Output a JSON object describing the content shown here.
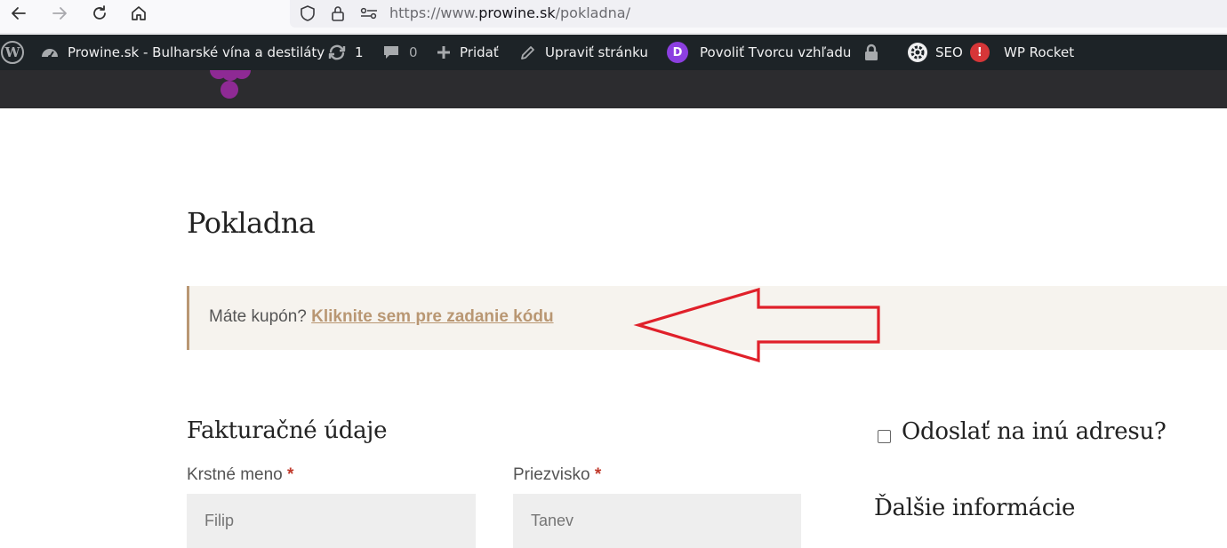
{
  "browser": {
    "url_prefix": "https://www.",
    "url_host": "prowine.sk",
    "url_path": "/pokladna/"
  },
  "admin_bar": {
    "site_name": "Prowine.sk - Bulharské vína a destiláty",
    "updates_count": "1",
    "comments_count": "0",
    "add_new_label": "Pridať",
    "edit_page_label": "Upraviť stránku",
    "divi_letter": "D",
    "divi_label": "Povoliť Tvorcu vzhľadu",
    "seo_label": "SEO",
    "seo_alert": "!",
    "wp_rocket_label": "WP Rocket"
  },
  "page": {
    "title": "Pokladna",
    "coupon": {
      "prompt": "Máte kupón?",
      "link": "Kliknite sem pre zadanie kódu"
    },
    "billing": {
      "heading": "Fakturačné údaje",
      "first_name_label": "Krstné meno",
      "last_name_label": "Priezvisko",
      "required_mark": "*",
      "first_name_placeholder": "Filip",
      "last_name_placeholder": "Tanev"
    },
    "shipping": {
      "ship_different_label": "Odoslať na inú adresu?"
    },
    "additional": {
      "heading": "Ďalšie informácie"
    }
  },
  "colors": {
    "admin_bar_bg": "#1d2327",
    "accent_link": "#b99773",
    "notice_bg": "#f6f3ee",
    "annotation_arrow": "#e0202a",
    "divi_purple": "#8c3fe0",
    "seo_alert_red": "#d63638"
  },
  "icons": [
    "back-arrow-icon",
    "forward-arrow-icon",
    "reload-icon",
    "home-icon",
    "shield-icon",
    "lock-icon",
    "site-settings-icon",
    "wordpress-logo-icon",
    "dashboard-icon",
    "updates-icon",
    "comment-icon",
    "plus-icon",
    "pencil-icon",
    "divi-icon",
    "padlock-icon",
    "seo-gear-icon",
    "grape-logo-icon",
    "red-arrow-annotation-icon"
  ]
}
